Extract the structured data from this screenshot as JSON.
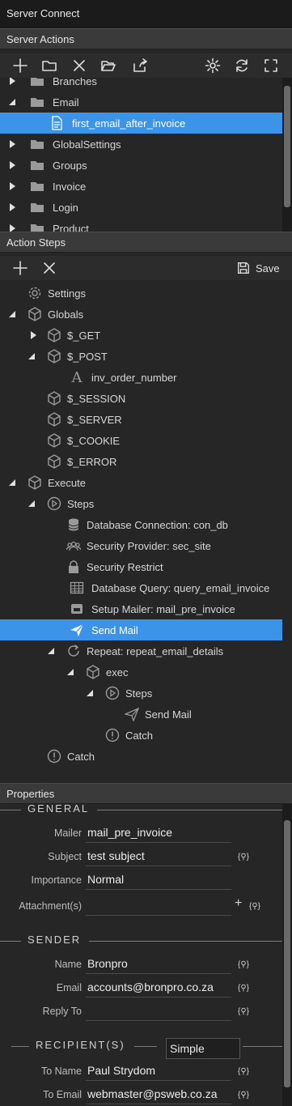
{
  "window": {
    "title": "Server Connect"
  },
  "server_actions": {
    "header": "Server Actions",
    "toolbar": [
      "add-icon",
      "folder-icon",
      "close-icon",
      "folder-open-icon",
      "share-icon",
      "gear-icon",
      "refresh-icon",
      "fullscreen-icon"
    ],
    "tree": [
      {
        "label": "Branches",
        "type": "folder",
        "expanded": false
      },
      {
        "label": "Email",
        "type": "folder",
        "expanded": true
      },
      {
        "label": "first_email_after_invoice",
        "type": "file",
        "selected": true
      },
      {
        "label": "GlobalSettings",
        "type": "folder",
        "expanded": false
      },
      {
        "label": "Groups",
        "type": "folder",
        "expanded": false
      },
      {
        "label": "Invoice",
        "type": "folder",
        "expanded": false
      },
      {
        "label": "Login",
        "type": "folder",
        "expanded": false
      },
      {
        "label": "Product",
        "type": "folder",
        "expanded": false
      }
    ]
  },
  "action_steps": {
    "header": "Action Steps",
    "save_label": "Save",
    "tree": [
      {
        "label": "Settings",
        "icon": "gear-icon"
      },
      {
        "label": "Globals",
        "icon": "cube-icon"
      },
      {
        "label": "$_GET",
        "icon": "cube-icon"
      },
      {
        "label": "$_POST",
        "icon": "cube-icon"
      },
      {
        "label": "inv_order_number",
        "icon": "text-icon"
      },
      {
        "label": "$_SESSION",
        "icon": "cube-icon"
      },
      {
        "label": "$_SERVER",
        "icon": "cube-icon"
      },
      {
        "label": "$_COOKIE",
        "icon": "cube-icon"
      },
      {
        "label": "$_ERROR",
        "icon": "cube-icon"
      },
      {
        "label": "Execute",
        "icon": "cube-icon"
      },
      {
        "label": "Steps",
        "icon": "play-circle-icon"
      },
      {
        "label": "Database Connection: con_db",
        "icon": "database-icon"
      },
      {
        "label": "Security Provider: sec_site",
        "icon": "users-icon"
      },
      {
        "label": "Security Restrict",
        "icon": "lock-icon"
      },
      {
        "label": "Database Query: query_email_invoice",
        "icon": "table-icon"
      },
      {
        "label": "Setup Mailer: mail_pre_invoice",
        "icon": "mailer-icon"
      },
      {
        "label": "Send Mail",
        "icon": "send-icon",
        "selected": true
      },
      {
        "label": "Repeat: repeat_email_details",
        "icon": "repeat-icon"
      },
      {
        "label": "exec",
        "icon": "cube-icon"
      },
      {
        "label": "Steps",
        "icon": "play-circle-icon"
      },
      {
        "label": "Send Mail",
        "icon": "send-icon"
      },
      {
        "label": "Catch",
        "icon": "alert-icon"
      },
      {
        "label": "Catch",
        "icon": "alert-icon"
      }
    ]
  },
  "properties": {
    "header": "Properties",
    "general_title": "GENERAL",
    "mailer_label": "Mailer",
    "mailer_value": "mail_pre_invoice",
    "subject_label": "Subject",
    "subject_value": "test subject",
    "importance_label": "Importance",
    "importance_value": "Normal",
    "attachments_label": "Attachment(s)",
    "attachments_value": "",
    "sender_title": "SENDER",
    "name_label": "Name",
    "name_value": "Bronpro",
    "email_label": "Email",
    "email_value": "accounts@bronpro.co.za",
    "replyto_label": "Reply To",
    "replyto_value": "",
    "recipients_title": "RECIPIENT(S)",
    "recipients_mode": "Simple",
    "toname_label": "To Name",
    "toname_value": "Paul Strydom",
    "toemail_label": "To Email",
    "toemail_value": "webmaster@psweb.co.za",
    "dynamic_glyph": "{⚲}"
  },
  "colors": {
    "accent": "#3b94e8",
    "panel": "#262626",
    "header": "#3a3a3a"
  }
}
